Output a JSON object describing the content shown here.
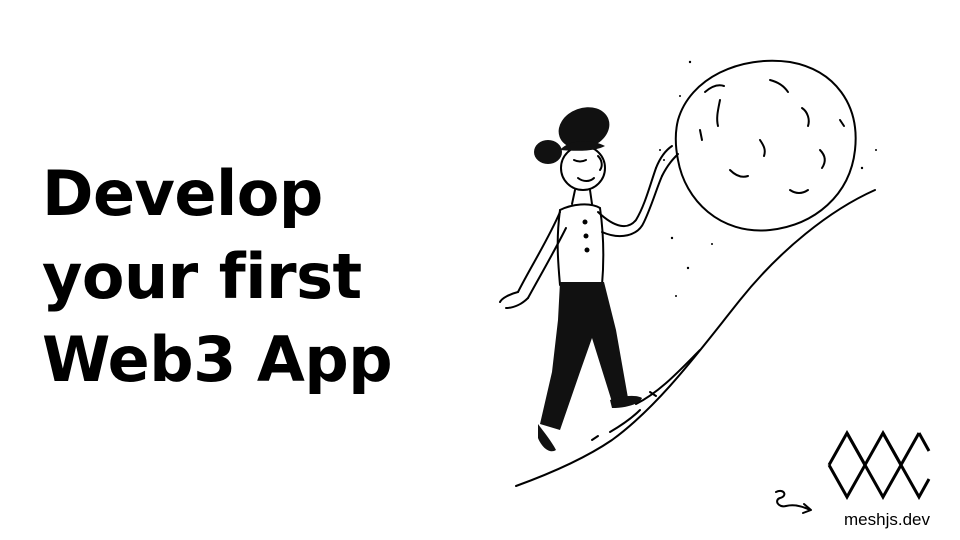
{
  "slide": {
    "headline_lines": [
      "Develop",
      "your first",
      "Web3 App"
    ],
    "brand_text": "meshjs.dev",
    "colors": {
      "text": "#000000",
      "background": "#ffffff"
    }
  },
  "icons": {
    "illustration": "person-pushing-boulder-uphill-icon",
    "logo": "mesh-triangles-logo-icon",
    "arrow": "squiggle-arrow-icon"
  }
}
